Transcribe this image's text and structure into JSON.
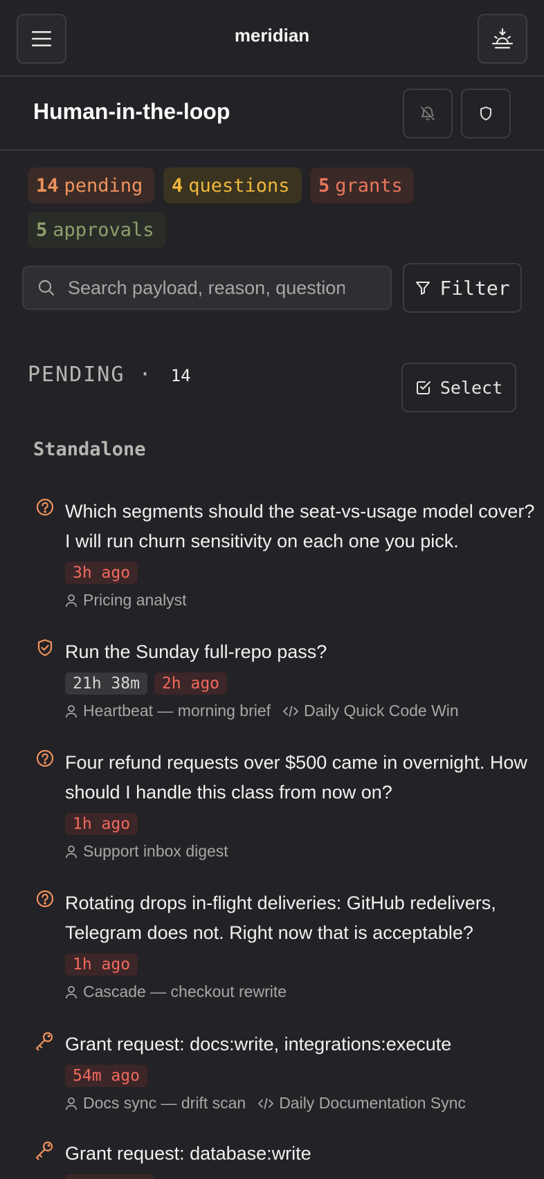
{
  "app": {
    "title": "meridian"
  },
  "page": {
    "title": "Human-in-the-loop"
  },
  "stats": {
    "pending": {
      "count": "14",
      "label": "pending"
    },
    "questions": {
      "count": "4",
      "label": "questions"
    },
    "grants": {
      "count": "5",
      "label": "grants"
    },
    "approvals": {
      "count": "5",
      "label": "approvals"
    }
  },
  "search": {
    "placeholder": "Search payload, reason, question",
    "value": ""
  },
  "filter": {
    "label": "Filter"
  },
  "section": {
    "label": "PENDING ·",
    "count": "14",
    "select_label": "Select"
  },
  "group": {
    "label": "Standalone"
  },
  "colors": {
    "accent_orange": "#f0935e",
    "accent_yellow": "#f1b83a",
    "accent_red": "#e8775d",
    "accent_green": "#8fa070"
  },
  "items": [
    {
      "icon": "question-circle-icon",
      "title": "Which segments should the seat-vs-usage model cover? I will run churn sensitivity on each one you pick.",
      "age": "3h ago",
      "agent": "Pricing analyst"
    },
    {
      "icon": "shield-check-icon",
      "title": "Run the Sunday full-repo pass?",
      "timer": "21h 38m",
      "age": "2h ago",
      "agent": "Heartbeat — morning brief",
      "routine": "Daily Quick Code Win"
    },
    {
      "icon": "question-circle-icon",
      "title": "Four refund requests over $500 came in overnight. How should I handle this class from now on?",
      "age": "1h ago",
      "agent": "Support inbox digest"
    },
    {
      "icon": "question-circle-icon",
      "title": "Rotating drops in-flight deliveries: GitHub redelivers, Telegram does not. Right now that is acceptable?",
      "age": "1h ago",
      "agent": "Cascade — checkout rewrite"
    },
    {
      "icon": "key-icon",
      "title": "Grant request: docs:write, integrations:execute",
      "age": "54m ago",
      "agent": "Docs sync — drift scan",
      "routine": "Daily Documentation Sync"
    },
    {
      "icon": "key-icon",
      "title": "Grant request: database:write"
    }
  ]
}
